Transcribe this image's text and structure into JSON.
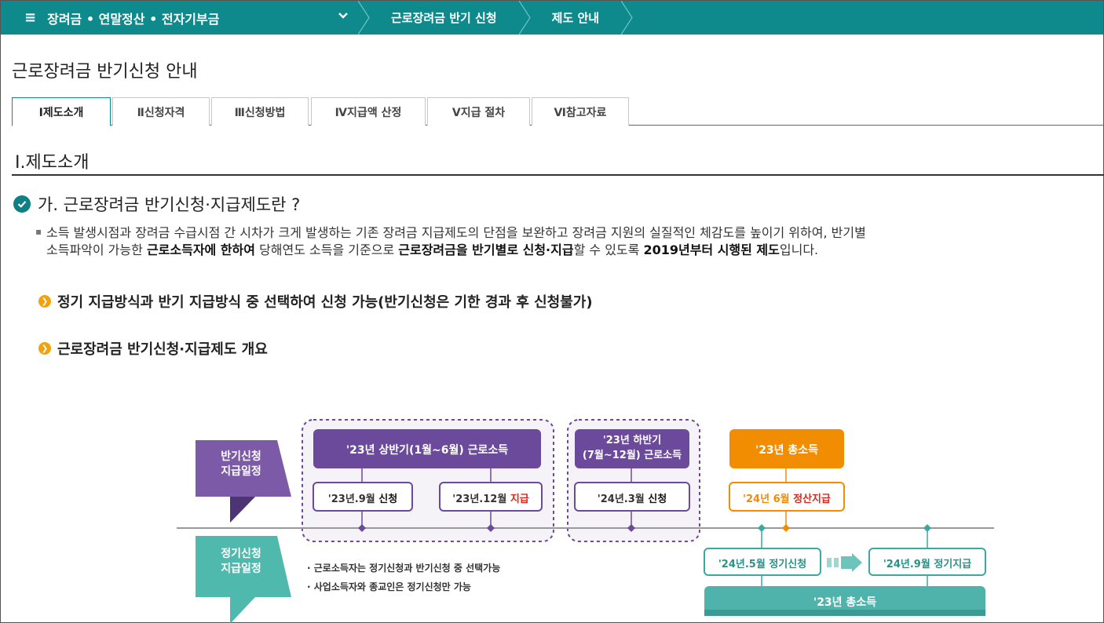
{
  "nav": {
    "menu_label": "장려금 • 연말정산 • 전자기부금",
    "crumb1": "근로장려금 반기 신청",
    "crumb2": "제도 안내"
  },
  "page_title": "근로장려금 반기신청 안내",
  "tabs": [
    {
      "label": "Ⅰ제도소개",
      "active": true
    },
    {
      "label": "Ⅱ신청자격"
    },
    {
      "label": "Ⅲ신청방법"
    },
    {
      "label": "Ⅳ지급액 산정"
    },
    {
      "label": "Ⅴ지급 절차"
    },
    {
      "label": "Ⅵ참고자료"
    }
  ],
  "section_title": "Ⅰ.제도소개",
  "question": "가. 근로장려금 반기신청·지급제도란 ?",
  "paragraph": {
    "line1": "소득 발생시점과 장려금 수급시점 간 시차가 크게 발생하는 기존 장려금 지급제도의 단점을 보완하고 장려금 지원의 실질적인 체감도를 높이기 위하여, 반기별",
    "line2_a": "소득파악이 가능한 ",
    "line2_b": "근로소득자에 한하여",
    "line2_c": " 당해연도 소득을 기준으로 ",
    "line2_d": "근로장려금을 반기별로 신청·지급",
    "line2_e": "할 수 있도록 ",
    "line2_f": "2019년부터 시행된 제도",
    "line2_g": "입니다."
  },
  "sub1": "정기 지급방식과 반기 지급방식 중 선택하여 신청 가능(반기신청은 기한 경과 후 신청불가)",
  "sub2": "근로장려금 반기신청·지급제도 개요",
  "diagram": {
    "half_label_1": "반기신청",
    "half_label_2": "지급일정",
    "regular_label_1": "정기신청",
    "regular_label_2": "지급일정",
    "h1_title": "'23년 상반기(1월~6월) 근로소득",
    "h1_apply_a": "'23년.9월 ",
    "h1_apply_b": "신청",
    "h1_pay_a": "'23년.12월 ",
    "h1_pay_b": "지급",
    "h2_title_1": "'23년 하반기",
    "h2_title_2": "(7월~12월) 근로소득",
    "h2_apply_a": "'24년.3월 ",
    "h2_apply_b": "신청",
    "total_title": "'23년 총소득",
    "total_pay_a": "'24년 6월 ",
    "total_pay_b": "정산지급",
    "reg_apply": "'24년.5월 정기신청",
    "reg_pay": "'24년.9월 정기지급",
    "reg_total": "'23년 총소득",
    "note1": "· 근로소득자는 정기신청과 반기신청 중 선택가능",
    "note2": "· 사업소득자와 종교인은 정기신청만 가능"
  },
  "colors": {
    "teal": "#0e8a8c",
    "purple": "#6b4a9b",
    "orange": "#f28c00",
    "red": "#e0251b"
  }
}
